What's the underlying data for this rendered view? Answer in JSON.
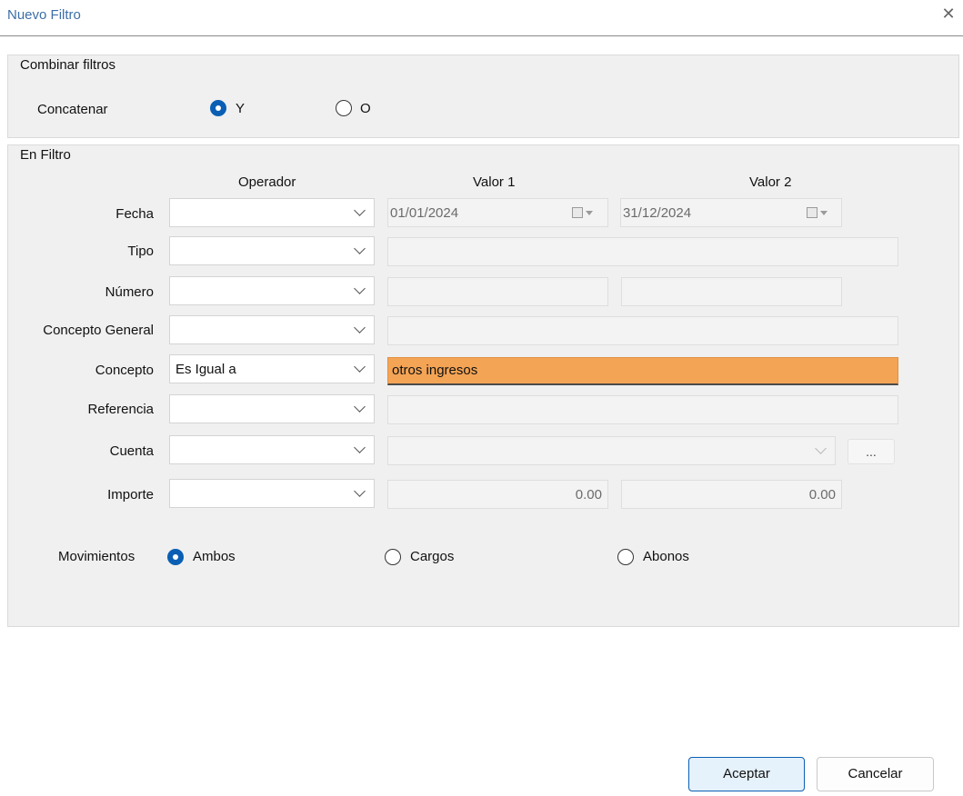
{
  "window": {
    "title": "Nuevo Filtro"
  },
  "combine": {
    "legend": "Combinar filtros",
    "label": "Concatenar",
    "options": [
      "Y",
      "O"
    ],
    "selected": "Y"
  },
  "filter": {
    "legend": "En Filtro",
    "headers": {
      "operator": "Operador",
      "value1": "Valor 1",
      "value2": "Valor 2"
    },
    "rows": {
      "fecha": {
        "label": "Fecha",
        "operator": "",
        "value1": "01/01/2024",
        "value2": "31/12/2024"
      },
      "tipo": {
        "label": "Tipo",
        "operator": "",
        "value1": ""
      },
      "numero": {
        "label": "Número",
        "operator": "",
        "value1": "",
        "value2": ""
      },
      "concepto_general": {
        "label": "Concepto General",
        "operator": "",
        "value1": ""
      },
      "concepto": {
        "label": "Concepto",
        "operator": "Es Igual a",
        "value1": "otros ingresos"
      },
      "referencia": {
        "label": "Referencia",
        "operator": "",
        "value1": ""
      },
      "cuenta": {
        "label": "Cuenta",
        "operator": "",
        "value1": "",
        "browse_label": "..."
      },
      "importe": {
        "label": "Importe",
        "operator": "",
        "value1": "0.00",
        "value2": "0.00"
      }
    },
    "movements": {
      "label": "Movimientos",
      "options": [
        "Ambos",
        "Cargos",
        "Abonos"
      ],
      "selected": "Ambos"
    }
  },
  "buttons": {
    "accept": "Aceptar",
    "cancel": "Cancelar"
  },
  "colors": {
    "highlight": "#f4a455",
    "accent": "#0a5fb4",
    "title": "#3c6ea8"
  }
}
